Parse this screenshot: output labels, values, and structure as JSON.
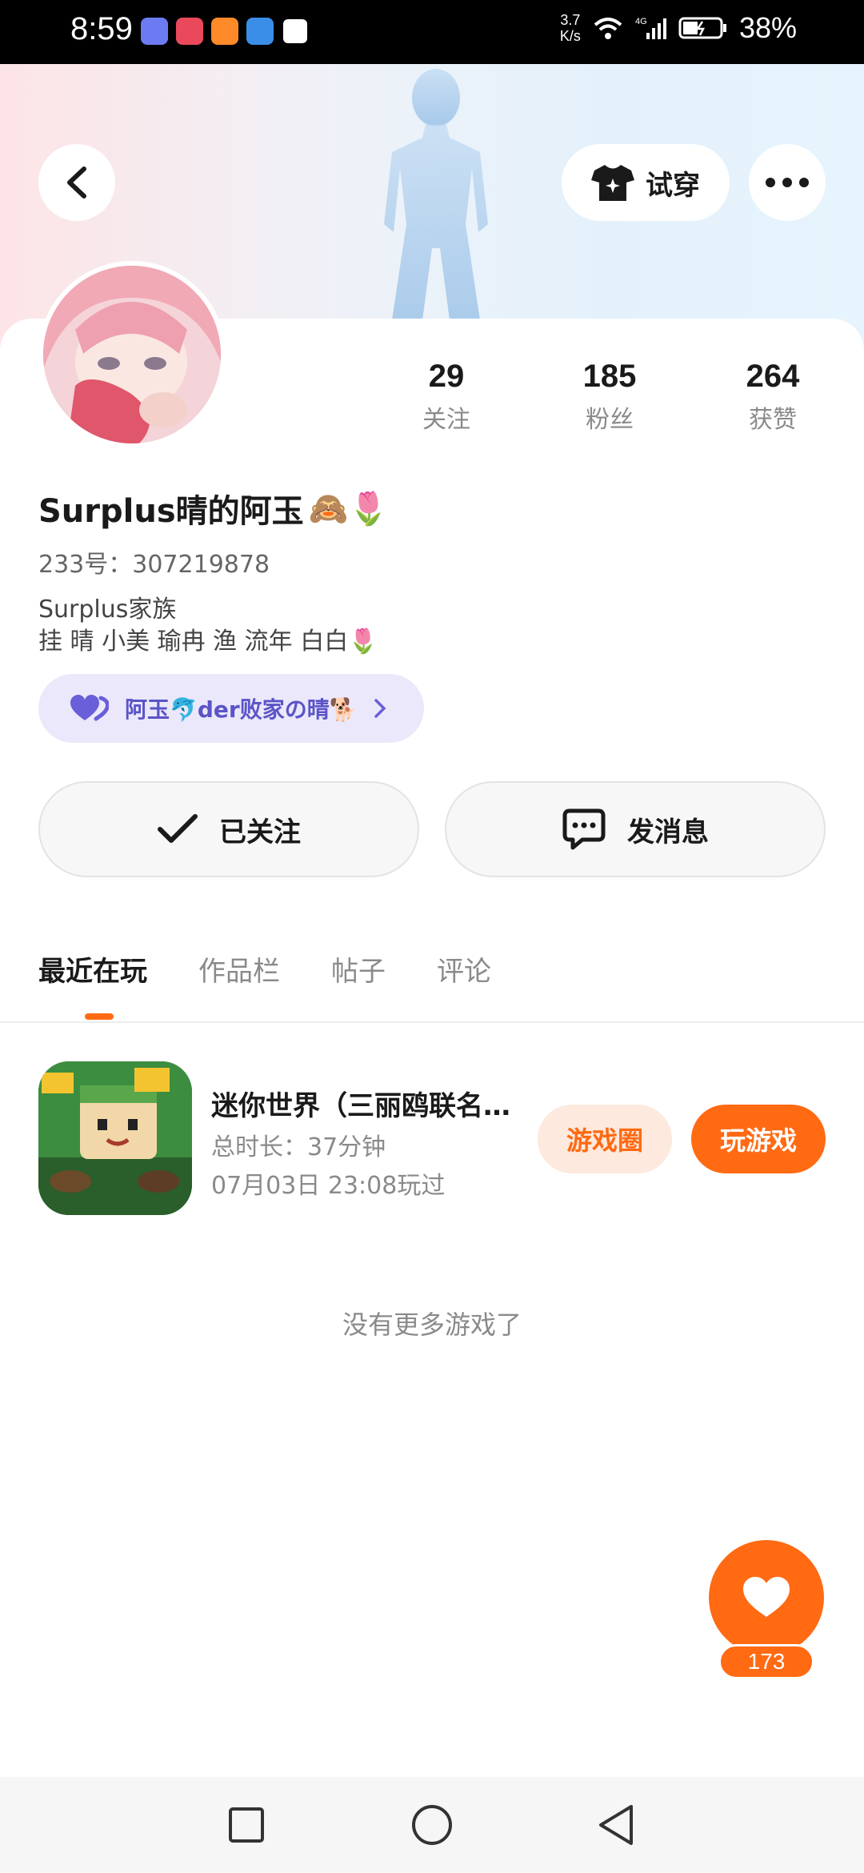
{
  "status_bar": {
    "time": "8:59",
    "net_speed_top": "3.7",
    "net_speed_bottom": "K/s",
    "network": "4G",
    "battery": "38%"
  },
  "header": {
    "tryon_label": "试穿",
    "icons": [
      "back-icon",
      "shirt-icon",
      "more-icon"
    ]
  },
  "profile": {
    "stats": [
      {
        "value": "29",
        "label": "关注"
      },
      {
        "value": "185",
        "label": "粉丝"
      },
      {
        "value": "264",
        "label": "获赞"
      }
    ],
    "username": "Surplus晴的阿玉",
    "username_emoji": "🙈🌷",
    "uid": "233号：307219878",
    "bio_line1": "Surplus家族",
    "bio_line2": "挂 晴 小美 瑜冉 渔 流年 白白🌷",
    "family_chip": "阿玉🐬der败家の晴🐕",
    "follow_label": "已关注",
    "message_label": "发消息"
  },
  "tabs": [
    "最近在玩",
    "作品栏",
    "帖子",
    "评论"
  ],
  "game": {
    "title": "迷你世界（三丽鸥联名版）",
    "duration": "总时长：37分钟",
    "last_played": "07月03日 23:08玩过",
    "circle_label": "游戏圈",
    "play_label": "玩游戏"
  },
  "no_more_text": "没有更多游戏了",
  "like_count": "173",
  "colors": {
    "accent": "#ff6a13",
    "chip_bg": "#ebe8fb",
    "chip_text": "#5b54c8"
  }
}
